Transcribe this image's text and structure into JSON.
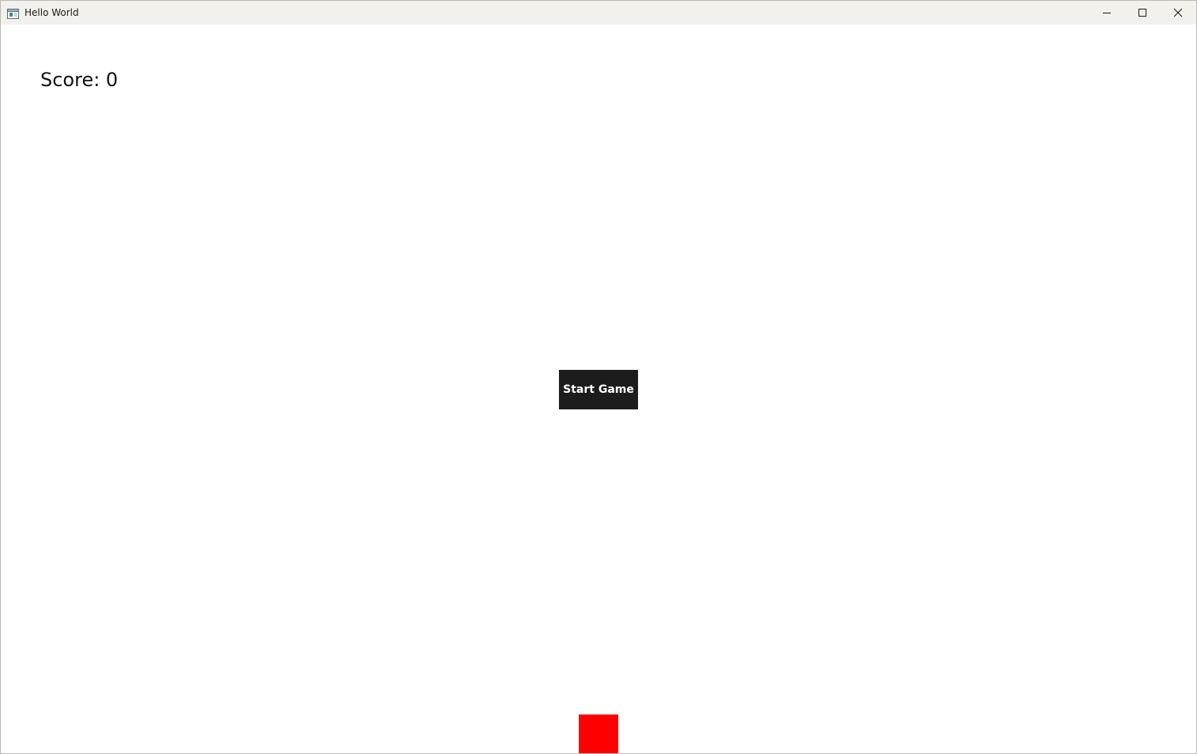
{
  "window": {
    "title": "Hello World",
    "icon": "app-window-icon",
    "controls": {
      "minimize_icon": "minimize-icon",
      "maximize_icon": "maximize-icon",
      "close_icon": "close-icon"
    }
  },
  "game": {
    "score_text": "Score: 0",
    "start_button_label": "Start Game",
    "player_color": "#ff0000",
    "button_color": "#1c1c1c"
  }
}
